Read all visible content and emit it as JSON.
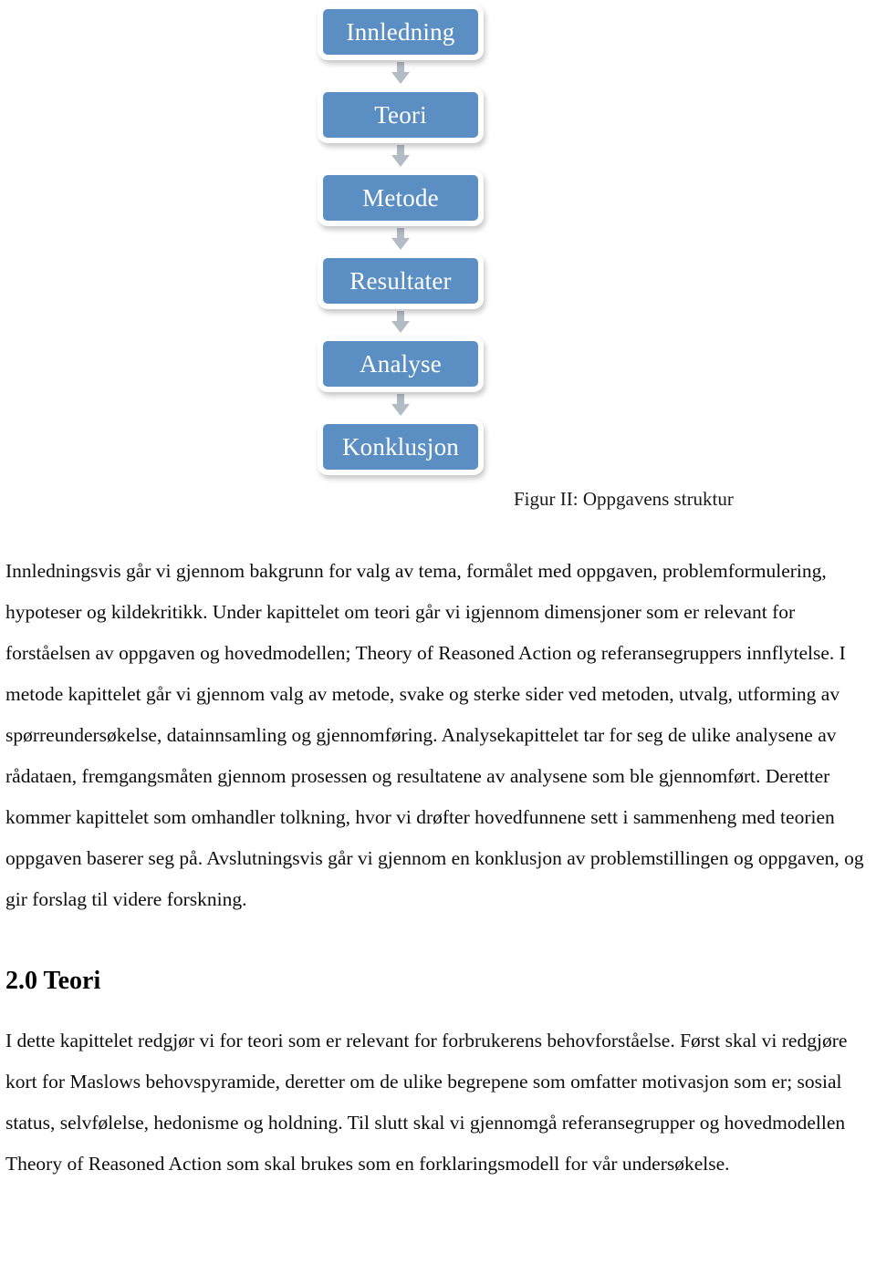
{
  "figure": {
    "nodes": [
      {
        "label": "Innledning"
      },
      {
        "label": "Teori"
      },
      {
        "label": "Metode"
      },
      {
        "label": "Resultater"
      },
      {
        "label": "Analyse"
      },
      {
        "label": "Konklusjon"
      }
    ],
    "arrow_icon": "arrow-down-icon",
    "caption": "Figur II: Oppgavens struktur",
    "node_fill_color": "#5b8fc4",
    "node_text_color": "#ffffff",
    "arrow_color": "#b3bbc4"
  },
  "content": {
    "paragraph_intro": "Innledningsvis går vi gjennom bakgrunn for valg av tema, formålet med oppgaven, problemformulering, hypoteser og kildekritikk. Under kapittelet om teori går vi igjennom dimensjoner som er relevant for forståelsen av oppgaven og hovedmodellen; Theory of Reasoned Action og referansegruppers innflytelse. I metode kapittelet går vi gjennom valg av metode, svake og sterke sider ved metoden, utvalg, utforming av spørreundersøkelse, datainnsamling og gjennomføring. Analysekapittelet tar for seg de ulike analysene av rådataen, fremgangsmåten gjennom prosessen og resultatene av analysene som ble gjennomført. Deretter kommer kapittelet som omhandler tolkning, hvor vi drøfter hovedfunnene sett i sammenheng med teorien oppgaven baserer seg på. Avslutningsvis går vi gjennom en konklusjon av problemstillingen og oppgaven, og gir forslag til videre forskning.",
    "heading_teori": "2.0 Teori",
    "paragraph_teori": "I dette kapittelet redgjør vi for teori som er relevant for forbrukerens behovforståelse. Først skal vi redgjøre kort for Maslows behovspyramide, deretter om de ulike begrepene som omfatter motivasjon som er; sosial status, selvfølelse, hedonisme og holdning. Til slutt skal vi gjennomgå referansegrupper og hovedmodellen Theory of Reasoned Action som skal brukes som en forklaringsmodell for vår undersøkelse."
  }
}
